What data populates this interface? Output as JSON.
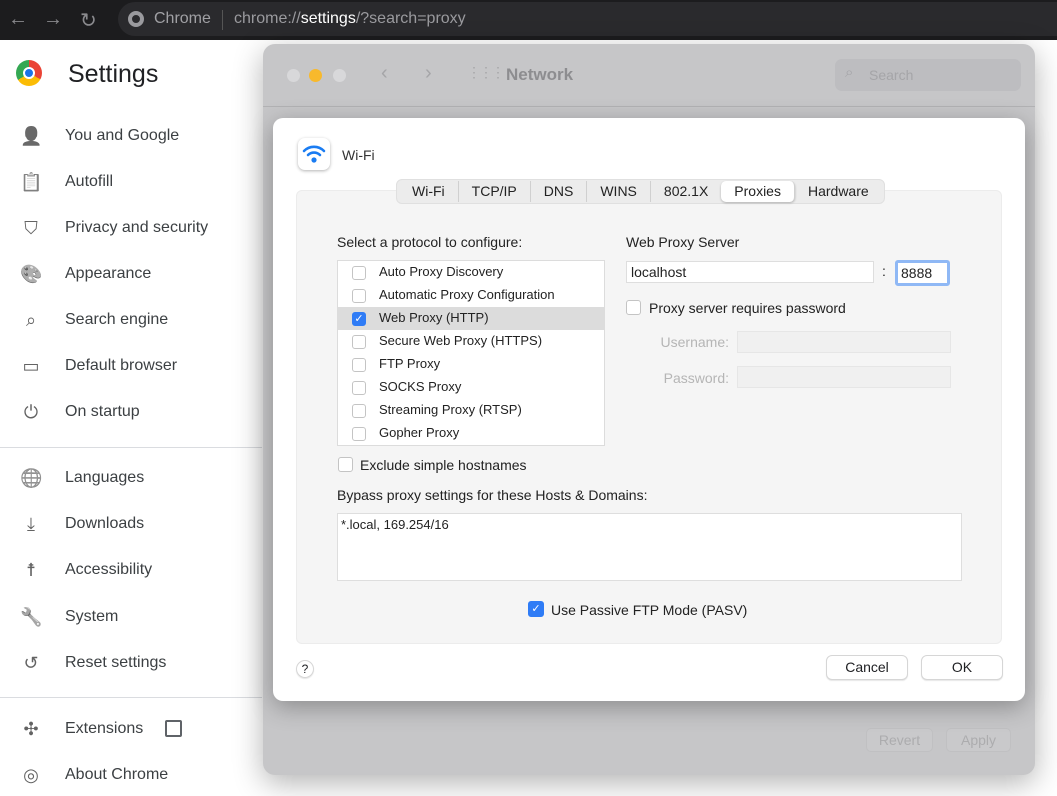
{
  "browser": {
    "chip": "Chrome",
    "url_prefix": "chrome://",
    "url_host": "settings",
    "url_rest": "/?search=proxy"
  },
  "settings": {
    "title": "Settings",
    "items": [
      {
        "label": "You and Google",
        "icon": "person-icon"
      },
      {
        "label": "Autofill",
        "icon": "clipboard-icon"
      },
      {
        "label": "Privacy and security",
        "icon": "shield-icon"
      },
      {
        "label": "Appearance",
        "icon": "palette-icon"
      },
      {
        "label": "Search engine",
        "icon": "search-icon"
      },
      {
        "label": "Default browser",
        "icon": "browser-icon"
      },
      {
        "label": "On startup",
        "icon": "power-icon"
      },
      {
        "label": "Languages",
        "icon": "globe-icon"
      },
      {
        "label": "Downloads",
        "icon": "download-icon"
      },
      {
        "label": "Accessibility",
        "icon": "accessibility-icon"
      },
      {
        "label": "System",
        "icon": "wrench-icon"
      },
      {
        "label": "Reset settings",
        "icon": "history-icon"
      },
      {
        "label": "Extensions",
        "icon": "puzzle-icon"
      },
      {
        "label": "About Chrome",
        "icon": "chrome-icon"
      }
    ]
  },
  "network": {
    "title": "Network",
    "search_placeholder": "Search",
    "revert": "Revert",
    "apply": "Apply"
  },
  "dialog": {
    "title": "Wi-Fi",
    "tabs": [
      "Wi-Fi",
      "TCP/IP",
      "DNS",
      "WINS",
      "802.1X",
      "Proxies",
      "Hardware"
    ],
    "active_tab": "Proxies",
    "protocol_label": "Select a protocol to configure:",
    "protocols": [
      {
        "label": "Auto Proxy Discovery",
        "checked": false
      },
      {
        "label": "Automatic Proxy Configuration",
        "checked": false
      },
      {
        "label": "Web Proxy (HTTP)",
        "checked": true
      },
      {
        "label": "Secure Web Proxy (HTTPS)",
        "checked": false
      },
      {
        "label": "FTP Proxy",
        "checked": false
      },
      {
        "label": "SOCKS Proxy",
        "checked": false
      },
      {
        "label": "Streaming Proxy (RTSP)",
        "checked": false
      },
      {
        "label": "Gopher Proxy",
        "checked": false
      }
    ],
    "server_label": "Web Proxy Server",
    "server": "localhost",
    "colon": ":",
    "port": "8888",
    "requires_password": "Proxy server requires password",
    "username_label": "Username:",
    "password_label": "Password:",
    "exclude_simple": "Exclude simple hostnames",
    "bypass_label": "Bypass proxy settings for these Hosts & Domains:",
    "bypass": "*.local, 169.254/16",
    "pasv": "Use Passive FTP Mode (PASV)",
    "pasv_checked": true,
    "help": "?",
    "cancel": "Cancel",
    "ok": "OK"
  },
  "colors": {
    "accent": "#2f7cf6",
    "chrome_bar": "#1c1c1e"
  }
}
